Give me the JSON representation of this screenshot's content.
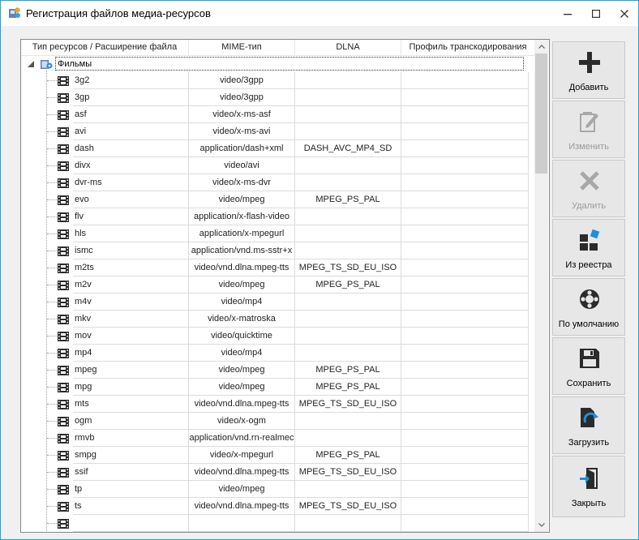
{
  "window": {
    "title": "Регистрация файлов медиа-ресурсов"
  },
  "table": {
    "columns": [
      "Тип ресурсов / Расширение файла",
      "MIME-тип",
      "DLNA",
      "Профиль транскодирования"
    ],
    "group_label": "Фильмы",
    "rows": [
      {
        "ext": "3g2",
        "mime": "video/3gpp",
        "dlna": "",
        "profile": ""
      },
      {
        "ext": "3gp",
        "mime": "video/3gpp",
        "dlna": "",
        "profile": ""
      },
      {
        "ext": "asf",
        "mime": "video/x-ms-asf",
        "dlna": "",
        "profile": ""
      },
      {
        "ext": "avi",
        "mime": "video/x-ms-avi",
        "dlna": "",
        "profile": ""
      },
      {
        "ext": "dash",
        "mime": "application/dash+xml",
        "dlna": "DASH_AVC_MP4_SD",
        "profile": ""
      },
      {
        "ext": "divx",
        "mime": "video/avi",
        "dlna": "",
        "profile": ""
      },
      {
        "ext": "dvr-ms",
        "mime": "video/x-ms-dvr",
        "dlna": "",
        "profile": ""
      },
      {
        "ext": "evo",
        "mime": "video/mpeg",
        "dlna": "MPEG_PS_PAL",
        "profile": ""
      },
      {
        "ext": "flv",
        "mime": "application/x-flash-video",
        "dlna": "",
        "profile": ""
      },
      {
        "ext": "hls",
        "mime": "application/x-mpegurl",
        "dlna": "",
        "profile": ""
      },
      {
        "ext": "ismc",
        "mime": "application/vnd.ms-sstr+x",
        "dlna": "",
        "profile": ""
      },
      {
        "ext": "m2ts",
        "mime": "video/vnd.dlna.mpeg-tts",
        "dlna": "MPEG_TS_SD_EU_ISO",
        "profile": ""
      },
      {
        "ext": "m2v",
        "mime": "video/mpeg",
        "dlna": "MPEG_PS_PAL",
        "profile": ""
      },
      {
        "ext": "m4v",
        "mime": "video/mp4",
        "dlna": "",
        "profile": ""
      },
      {
        "ext": "mkv",
        "mime": "video/x-matroska",
        "dlna": "",
        "profile": ""
      },
      {
        "ext": "mov",
        "mime": "video/quicktime",
        "dlna": "",
        "profile": ""
      },
      {
        "ext": "mp4",
        "mime": "video/mp4",
        "dlna": "",
        "profile": ""
      },
      {
        "ext": "mpeg",
        "mime": "video/mpeg",
        "dlna": "MPEG_PS_PAL",
        "profile": ""
      },
      {
        "ext": "mpg",
        "mime": "video/mpeg",
        "dlna": "MPEG_PS_PAL",
        "profile": ""
      },
      {
        "ext": "mts",
        "mime": "video/vnd.dlna.mpeg-tts",
        "dlna": "MPEG_TS_SD_EU_ISO",
        "profile": ""
      },
      {
        "ext": "ogm",
        "mime": "video/x-ogm",
        "dlna": "",
        "profile": ""
      },
      {
        "ext": "rmvb",
        "mime": "application/vnd.rn-realmec",
        "dlna": "",
        "profile": ""
      },
      {
        "ext": "smpg",
        "mime": "video/x-mpegurl",
        "dlna": "MPEG_PS_PAL",
        "profile": ""
      },
      {
        "ext": "ssif",
        "mime": "video/vnd.dlna.mpeg-tts",
        "dlna": "MPEG_TS_SD_EU_ISO",
        "profile": ""
      },
      {
        "ext": "tp",
        "mime": "video/mpeg",
        "dlna": "",
        "profile": ""
      },
      {
        "ext": "ts",
        "mime": "video/vnd.dlna.mpeg-tts",
        "dlna": "MPEG_TS_SD_EU_ISO",
        "profile": ""
      },
      {
        "ext": "",
        "mime": "",
        "dlna": "",
        "profile": ""
      }
    ]
  },
  "buttons": {
    "add": "Добавить",
    "edit": "Изменить",
    "delete": "Удалить",
    "from_registry": "Из реестра",
    "defaults": "По умолчанию",
    "save": "Сохранить",
    "load": "Загрузить",
    "close": "Закрыть"
  },
  "colors": {
    "window_border": "#1ba1e2",
    "button_bg": "#e7e7e7",
    "disabled_text": "#9a9a9a",
    "icon_dark": "#2b2b2b",
    "icon_blue": "#1e90d8"
  }
}
